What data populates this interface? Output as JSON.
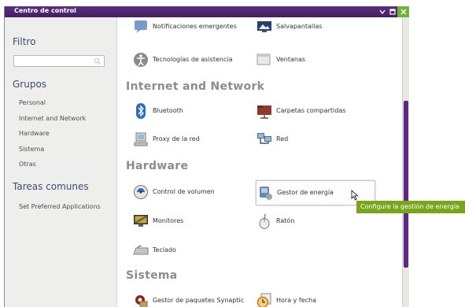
{
  "window": {
    "title": "Centro de control"
  },
  "sidebar": {
    "filter": {
      "heading": "Filtro",
      "value": "",
      "placeholder": ""
    },
    "groups": {
      "heading": "Grupos",
      "items": [
        "Personal",
        "Internet and Network",
        "Hardware",
        "Sistema",
        "Otras"
      ]
    },
    "common_tasks": {
      "heading": "Tareas comunes",
      "items": [
        "Set Preferred Applications"
      ]
    }
  },
  "main": {
    "personal_items": [
      "Notificaciones emergentes",
      "Salvapantallas",
      "Tecnologías de asistencia",
      "Ventanas"
    ],
    "categories": {
      "internet": {
        "title": "Internet and Network",
        "items": [
          "Bluetooth",
          "Carpetas compartidas",
          "Proxy de la red",
          "Red"
        ]
      },
      "hardware": {
        "title": "Hardware",
        "items": [
          "Control de volumen",
          "Gestor de energía",
          "Monitores",
          "Ratón",
          "Teclado"
        ]
      },
      "sistema": {
        "title": "Sistema",
        "items": [
          "Gestor de paquetes Synaptic",
          "Hora y fecha"
        ]
      }
    }
  },
  "tooltip": {
    "text": "Configure la gestión de energía"
  },
  "colors": {
    "titlebar": "#4f2770",
    "accent": "#5c2a82",
    "close_button": "#6fb23a",
    "tooltip": "#7aa41d",
    "category_text": "#8c8c8c"
  }
}
